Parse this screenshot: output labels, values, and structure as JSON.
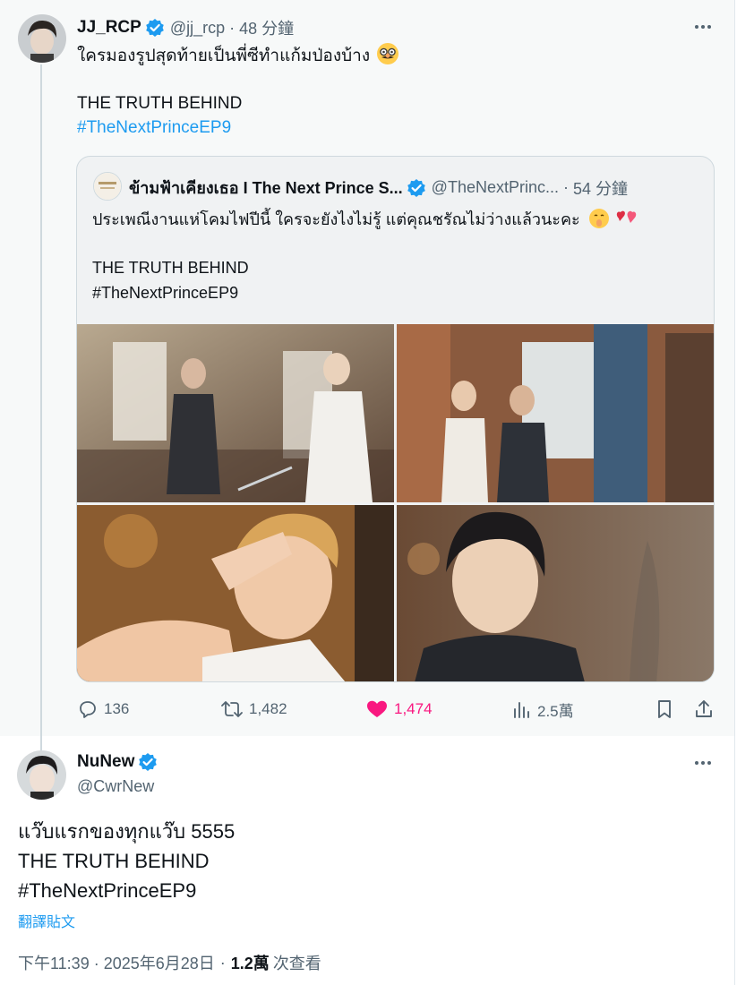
{
  "colors": {
    "accent": "#1d9bf0",
    "like_pink": "#f91880",
    "muted": "#536471",
    "context_bg": "#f7f9f9"
  },
  "context_tweet": {
    "display_name": "JJ_RCP",
    "handle": "@jj_rcp",
    "separator": "·",
    "time": "48 分鐘",
    "verified": true,
    "text_line_1": "ใครมองรูปสุดท้ายเป็นพี่ซีทำแก้มป่องบ้าง",
    "emoji_icon": "disguised-face-emoji",
    "text_line_2": "THE TRUTH BEHIND",
    "hashtag": "#TheNextPrinceEP9",
    "quote": {
      "display_name": "ข้ามฟ้าเคียงเธอ I The Next Prince S...",
      "handle": "@TheNextPrinc...",
      "separator": "·",
      "time": "54 分鐘",
      "verified": true,
      "text_line_1": "ประเพณีงานแห่โคมไฟปีนี้ ใครจะยังไงไม่รู้ แต่คุณชรัณไม่ว่างแล้วนะคะ",
      "emoji_icons": [
        "shushing-face-emoji",
        "two-hearts-emoji"
      ],
      "text_line_2": "THE TRUTH BEHIND",
      "text_line_3": "#TheNextPrinceEP9",
      "media": [
        "photo-1",
        "photo-2",
        "photo-3",
        "photo-4"
      ]
    },
    "actions": {
      "replies": "136",
      "reposts": "1,482",
      "likes": "1,474",
      "views": "2.5萬"
    }
  },
  "main_tweet": {
    "display_name": "NuNew",
    "handle": "@CwrNew",
    "verified": true,
    "line_1": "แว๊บแรกของทุกแว๊บ 5555",
    "line_2": "THE TRUTH BEHIND",
    "hashtag": "#TheNextPrinceEP9",
    "translate_label": "翻譯貼文",
    "timestamp": "下午11:39 · 2025年6月28日",
    "separator": "·",
    "views_count": "1.2萬",
    "views_label": "次查看"
  }
}
